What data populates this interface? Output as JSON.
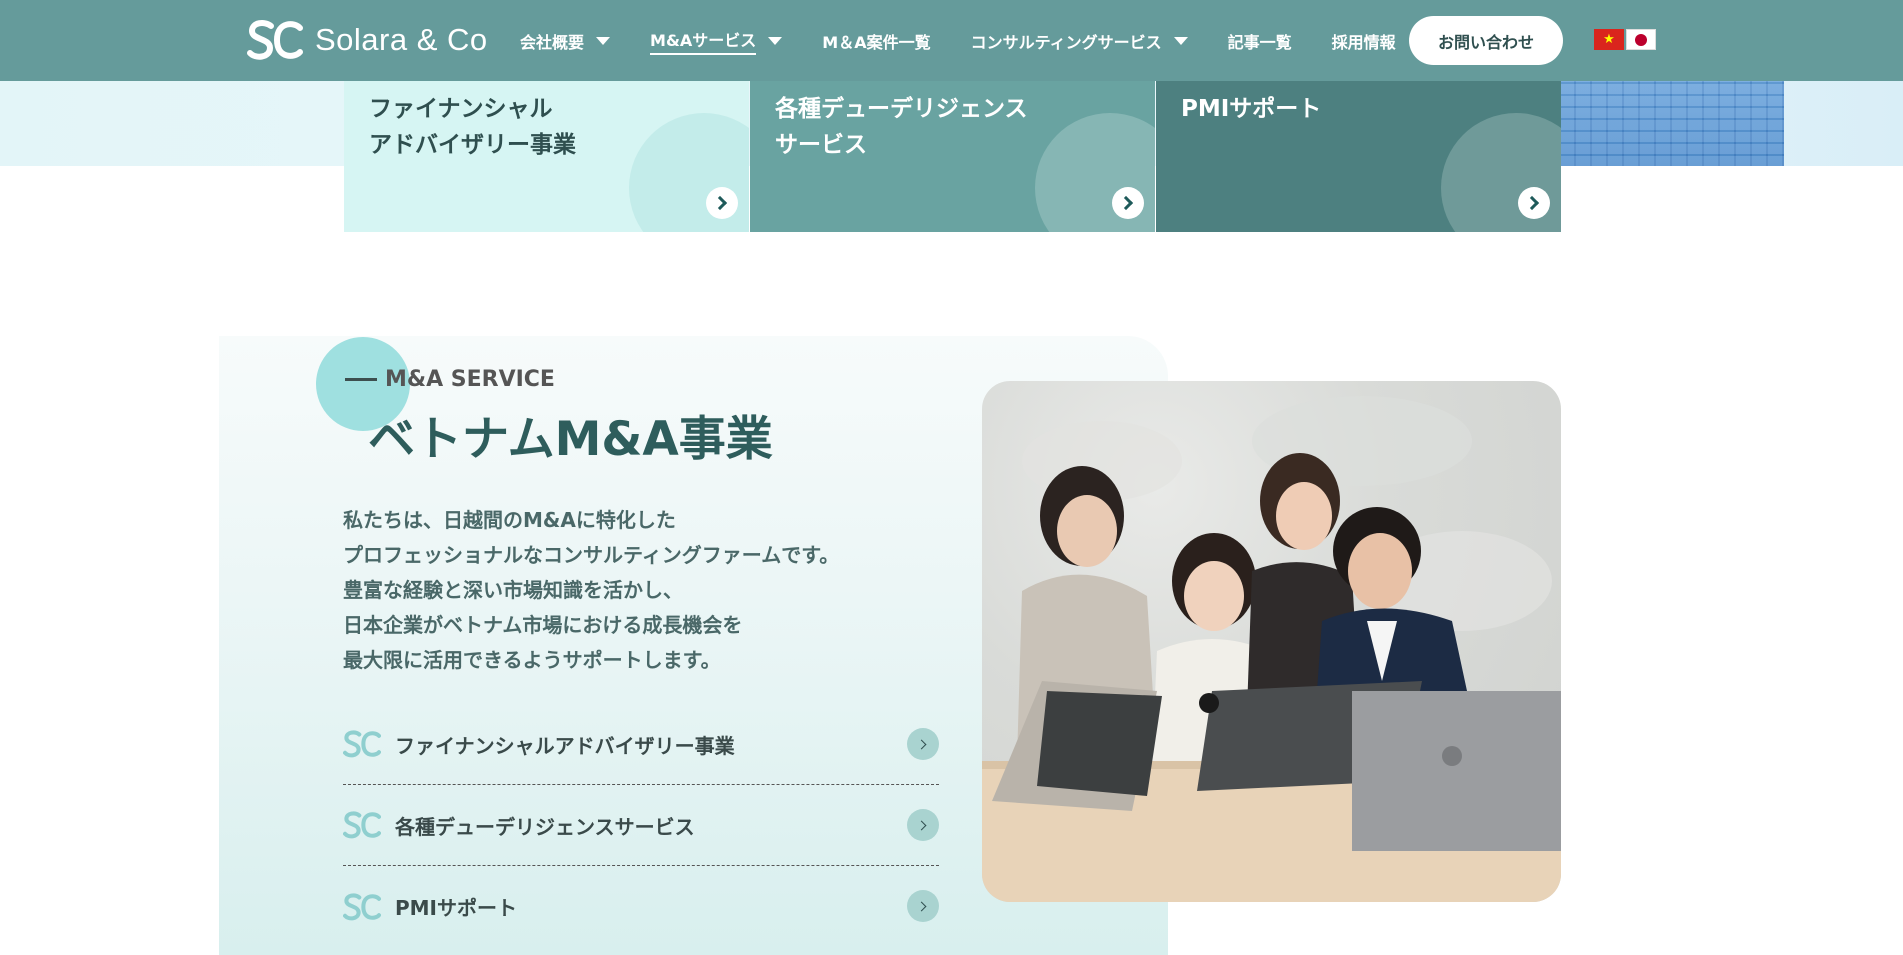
{
  "header": {
    "logo_text": "Solara & Co",
    "nav": [
      {
        "label": "会社概要",
        "has_dropdown": true,
        "active": false
      },
      {
        "label": "M&Aサービス",
        "has_dropdown": true,
        "active": true
      },
      {
        "label": "M＆A案件一覧",
        "has_dropdown": false,
        "active": false
      },
      {
        "label": "コンサルティングサービス",
        "has_dropdown": true,
        "active": false
      },
      {
        "label": "記事一覧",
        "has_dropdown": false,
        "active": false
      },
      {
        "label": "採用情報",
        "has_dropdown": false,
        "active": false
      }
    ],
    "contact_label": "お問い合わせ",
    "flag_vn_star": "★",
    "colors": {
      "header_bg": "#659b9b"
    }
  },
  "cards": [
    {
      "line1": "ファイナンシャル",
      "line2": "アドバイザリー事業"
    },
    {
      "line1": "各種デューデリジェンス",
      "line2": "サービス"
    },
    {
      "line1": "PMIサポート",
      "line2": ""
    }
  ],
  "ma_section": {
    "eyebrow": "M&A SERVICE",
    "title": "ベトナムM&A事業",
    "description": [
      "私たちは、日越間のM&Aに特化した",
      "プロフェッショナルなコンサルティングファームです。",
      "豊富な経験と深い市場知識を活かし、",
      "日本企業がベトナム市場における成長機会を",
      "最大限に活用できるようサポートします。"
    ],
    "links": [
      {
        "label": "ファイナンシャルアドバイザリー事業"
      },
      {
        "label": "各種デューデリジェンスサービス"
      },
      {
        "label": "PMIサポート"
      }
    ]
  }
}
